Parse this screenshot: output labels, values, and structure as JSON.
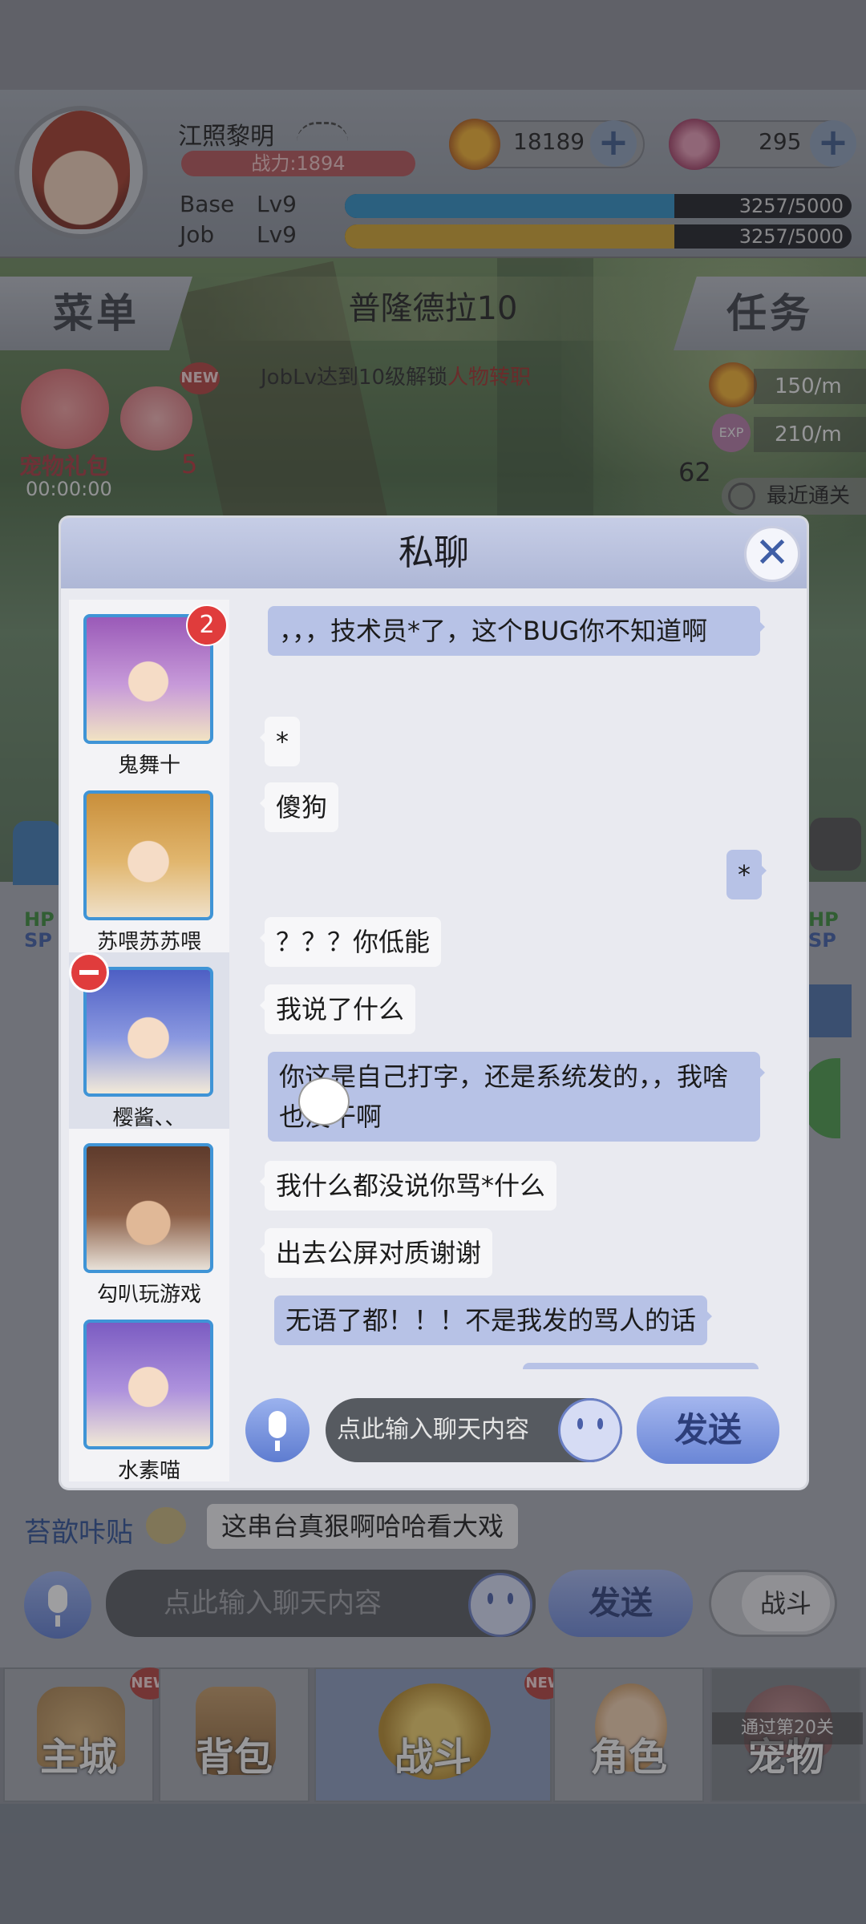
{
  "player": {
    "name": "江照黎明",
    "power": "战力:1894",
    "base_label": "Base",
    "base_lv": "Lv9",
    "base_exp": "3257/5000",
    "base_progress": 0.65,
    "job_label": "Job",
    "job_lv": "Lv9",
    "job_exp": "3257/5000",
    "job_progress": 0.65
  },
  "currency": {
    "gold": "18189",
    "gem": "295"
  },
  "nav": {
    "menu": "菜单",
    "quest": "任务",
    "stage": "普隆德拉10"
  },
  "hint": {
    "prefix": "JobLv达到10级解锁",
    "link": "人物转职"
  },
  "pet_gift": {
    "label": "宠物礼包",
    "timer": "00:00:00",
    "count": "5"
  },
  "rates": {
    "gold": "150/m",
    "exp": "210/m",
    "exp_label": "EXP",
    "recent": "最近通关",
    "level_num": "62"
  },
  "side": {
    "hp": "HP",
    "sp": "SP"
  },
  "private_chat": {
    "title": "私聊",
    "contacts": [
      {
        "name": "鬼舞十",
        "unread": "2"
      },
      {
        "name": "苏喂苏苏喂"
      },
      {
        "name": "樱酱、、"
      },
      {
        "name": "勾叭玩游戏"
      },
      {
        "name": "水素喵"
      }
    ],
    "messages": [
      {
        "text": "，，，技术员*了，这个BUG你不知道啊"
      },
      {
        "text": "*"
      },
      {
        "text": "傻狗"
      },
      {
        "text": "*"
      },
      {
        "text": "？？？你低能"
      },
      {
        "text": "我说了什么"
      },
      {
        "text": "你这是自己打字，还是系统发的，，我啥也没干啊"
      },
      {
        "text": "我什么都没说你骂*什么"
      },
      {
        "text": "出去公屏对质谢谢"
      },
      {
        "text": "无语了都！！！不是我发的骂人的话"
      }
    ],
    "input_placeholder": "点此输入聊天内容",
    "send": "发送"
  },
  "world_chat": {
    "name": "苔歆咔贴",
    "message": "这串台真狠啊哈哈看大戏",
    "input_placeholder": "点此输入聊天内容",
    "send": "发送",
    "toggle": "战斗"
  },
  "bottom_nav": {
    "main_city": "主城",
    "bag": "背包",
    "battle": "战斗",
    "role": "角色",
    "pet": "宠物",
    "pet_lock": "通过第20关",
    "new": "NEW"
  },
  "colors": {
    "accent": "#6a86d6",
    "badge": "#e03c3c",
    "base_bar": "#2e8fc4",
    "job_bar": "#d2a52e"
  }
}
